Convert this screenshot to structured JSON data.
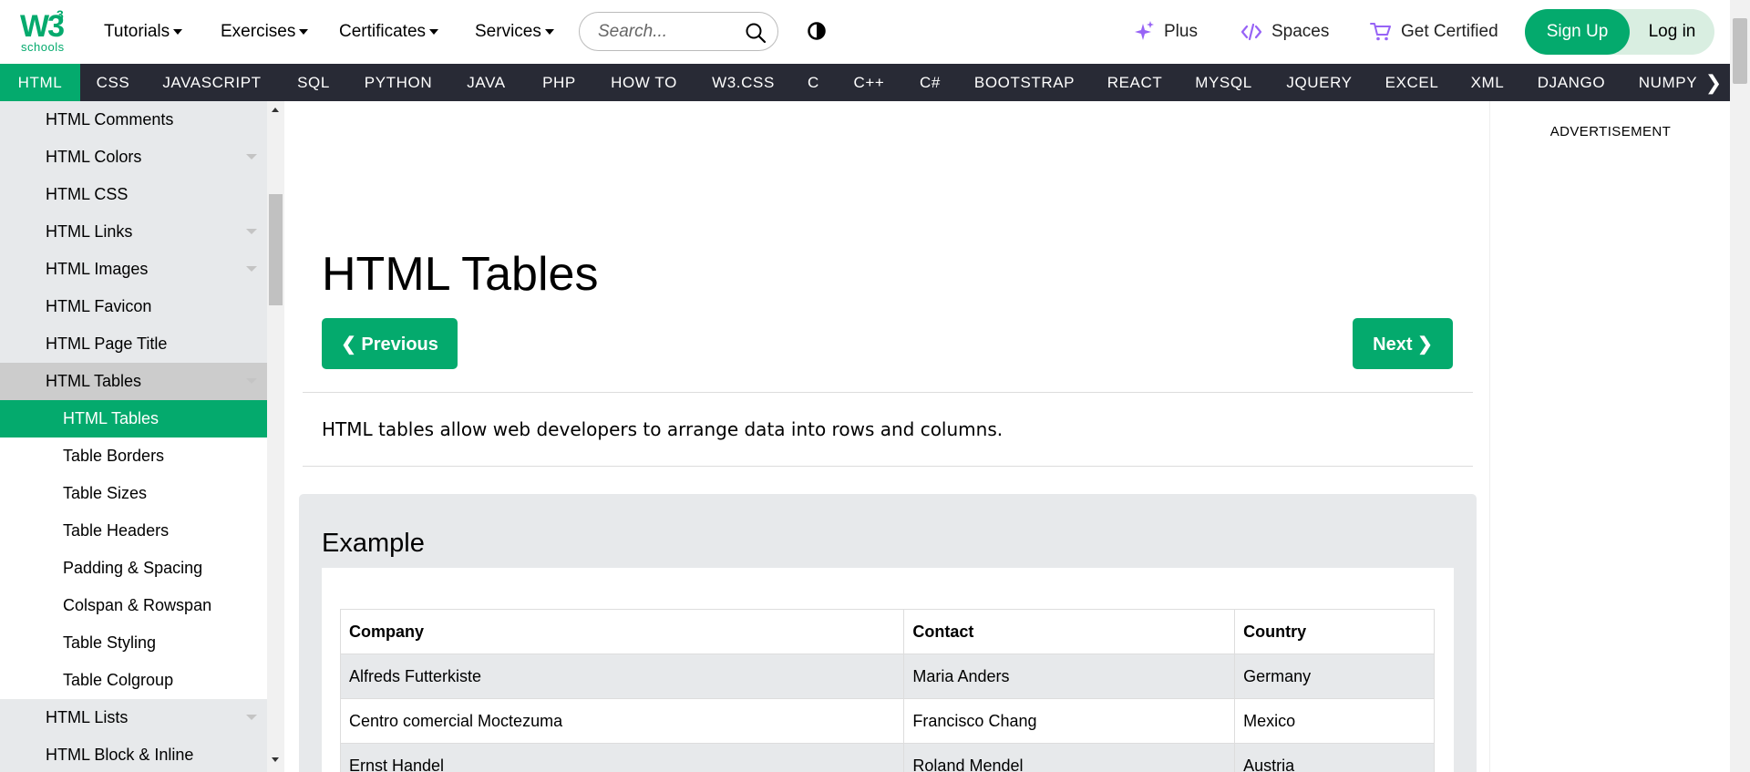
{
  "logo": {
    "main": "W3",
    "sup": "3",
    "text": "schools"
  },
  "menu": {
    "tutorials": "Tutorials",
    "exercises": "Exercises",
    "certificates": "Certificates",
    "services": "Services"
  },
  "search": {
    "placeholder": "Search..."
  },
  "header_links": {
    "plus": "Plus",
    "spaces": "Spaces",
    "get_certified": "Get Certified"
  },
  "auth": {
    "signup": "Sign Up",
    "login": "Log in"
  },
  "subnav": [
    "HTML",
    "CSS",
    "JAVASCRIPT",
    "SQL",
    "PYTHON",
    "JAVA",
    "PHP",
    "HOW TO",
    "W3.CSS",
    "C",
    "C++",
    "C#",
    "BOOTSTRAP",
    "REACT",
    "MYSQL",
    "JQUERY",
    "EXCEL",
    "XML",
    "DJANGO",
    "NUMPY"
  ],
  "sidebar": {
    "items": [
      "HTML Comments",
      "HTML Colors",
      "HTML CSS",
      "HTML Links",
      "HTML Images",
      "HTML Favicon",
      "HTML Page Title",
      "HTML Tables",
      "HTML Tables",
      "Table Borders",
      "Table Sizes",
      "Table Headers",
      "Padding & Spacing",
      "Colspan & Rowspan",
      "Table Styling",
      "Table Colgroup",
      "HTML Lists",
      "HTML Block & Inline"
    ]
  },
  "main": {
    "title": "HTML Tables",
    "prev": "❮ Previous",
    "next": "Next ❯",
    "intro": "HTML tables allow web developers to arrange data into rows and columns.",
    "example_heading": "Example"
  },
  "table": {
    "headers": [
      "Company",
      "Contact",
      "Country"
    ],
    "rows": [
      [
        "Alfreds Futterkiste",
        "Maria Anders",
        "Germany"
      ],
      [
        "Centro comercial Moctezuma",
        "Francisco Chang",
        "Mexico"
      ],
      [
        "Ernst Handel",
        "Roland Mendel",
        "Austria"
      ]
    ]
  },
  "ad": {
    "label": "ADVERTISEMENT"
  },
  "colors": {
    "accent": "#04AA6D",
    "subnav_bg": "#282A35",
    "sidebar_bg": "#E7E9EB",
    "plus_icon": "#9763f6"
  }
}
